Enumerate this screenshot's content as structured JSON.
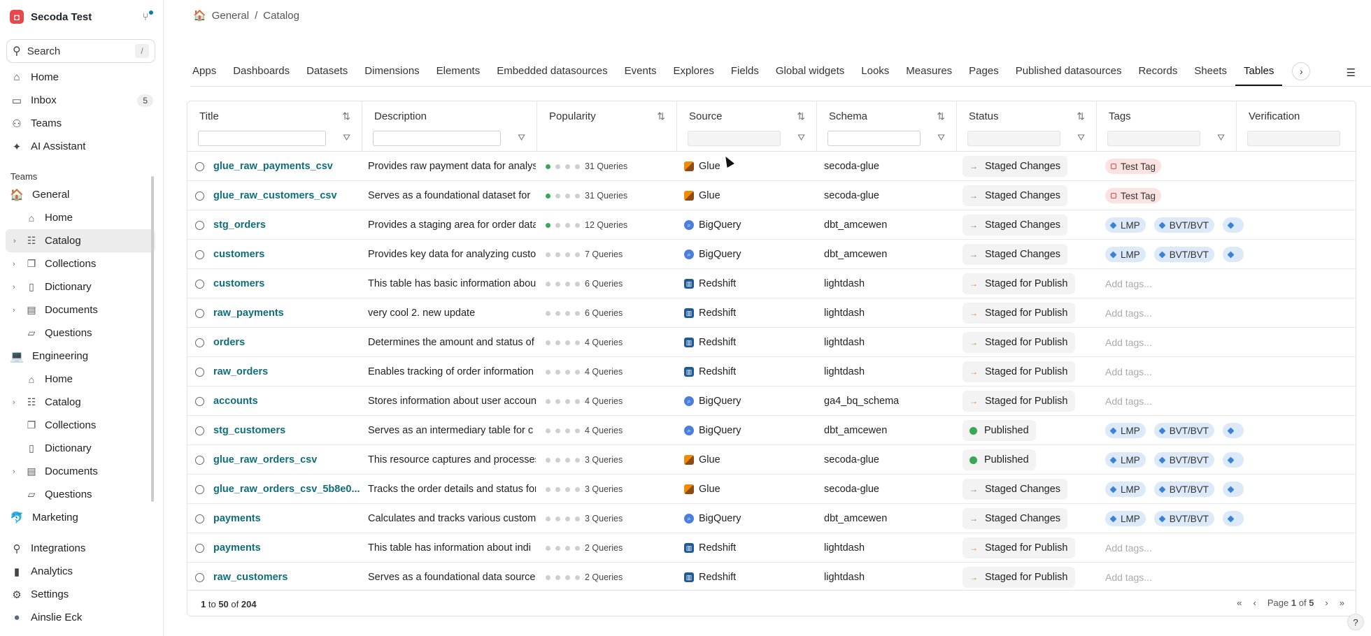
{
  "sidebar": {
    "workspace": "Secoda Test",
    "search": {
      "placeholder": "Search",
      "shortcut": "/"
    },
    "top_items": [
      {
        "label": "Home",
        "icon": "home-icon"
      },
      {
        "label": "Inbox",
        "icon": "inbox-icon",
        "badge": "5"
      },
      {
        "label": "Teams",
        "icon": "users-icon"
      },
      {
        "label": "AI Assistant",
        "icon": "sparkle-icon"
      }
    ],
    "teams_label": "Teams",
    "teams": [
      {
        "name": "General",
        "emoji": "🏠",
        "items": [
          {
            "label": "Home",
            "caret": false,
            "active": false
          },
          {
            "label": "Catalog",
            "caret": true,
            "active": true
          },
          {
            "label": "Collections",
            "caret": true,
            "active": false
          },
          {
            "label": "Dictionary",
            "caret": true,
            "active": false
          },
          {
            "label": "Documents",
            "caret": true,
            "active": false
          },
          {
            "label": "Questions",
            "caret": false,
            "active": false
          }
        ]
      },
      {
        "name": "Engineering",
        "emoji": "💻",
        "items": [
          {
            "label": "Home",
            "caret": false,
            "active": false
          },
          {
            "label": "Catalog",
            "caret": true,
            "active": false
          },
          {
            "label": "Collections",
            "caret": false,
            "active": false
          },
          {
            "label": "Dictionary",
            "caret": false,
            "active": false
          },
          {
            "label": "Documents",
            "caret": true,
            "active": false
          },
          {
            "label": "Questions",
            "caret": false,
            "active": false
          }
        ]
      },
      {
        "name": "Marketing",
        "emoji": "🐬",
        "items": []
      }
    ],
    "bottom_items": [
      {
        "label": "Integrations",
        "icon": "plug-icon"
      },
      {
        "label": "Analytics",
        "icon": "chart-icon"
      },
      {
        "label": "Settings",
        "icon": "gear-icon"
      },
      {
        "label": "Ainslie Eck",
        "icon": "avatar"
      }
    ]
  },
  "breadcrumb": {
    "team": "General",
    "sep": "/",
    "page": "Catalog"
  },
  "tabs": [
    "Apps",
    "Dashboards",
    "Datasets",
    "Dimensions",
    "Elements",
    "Embedded datasources",
    "Events",
    "Explores",
    "Fields",
    "Global widgets",
    "Looks",
    "Measures",
    "Pages",
    "Published datasources",
    "Records",
    "Sheets",
    "Tables"
  ],
  "active_tab": "Tables",
  "columns": {
    "title": "Title",
    "description": "Description",
    "popularity": "Popularity",
    "source": "Source",
    "schema": "Schema",
    "status": "Status",
    "tags": "Tags",
    "verification": "Verification"
  },
  "rows": [
    {
      "title": "glue_raw_payments_csv",
      "desc": "Provides raw payment data for analysis",
      "pop": 1,
      "queries": "31 Queries",
      "source": "Glue",
      "src": "glue",
      "schema": "secoda-glue",
      "status": "Staged Changes",
      "st": "changes",
      "tags": [
        {
          "t": "Test Tag",
          "k": "test"
        }
      ]
    },
    {
      "title": "glue_raw_customers_csv",
      "desc": "Serves as a foundational dataset for",
      "pop": 1,
      "queries": "31 Queries",
      "source": "Glue",
      "src": "glue",
      "schema": "secoda-glue",
      "status": "Staged Changes",
      "st": "changes",
      "tags": [
        {
          "t": "Test Tag",
          "k": "test"
        }
      ]
    },
    {
      "title": "stg_orders",
      "desc": "Provides a staging area for order data",
      "pop": 1,
      "queries": "12 Queries",
      "source": "BigQuery",
      "src": "bq",
      "schema": "dbt_amcewen",
      "status": "Staged Changes",
      "st": "changes",
      "tags": [
        {
          "t": "LMP",
          "k": "blue"
        },
        {
          "t": "BVT/BVT",
          "k": "blue"
        },
        {
          "t": "",
          "k": "blue"
        }
      ]
    },
    {
      "title": "customers",
      "desc": "Provides key data for analyzing customers",
      "pop": 0,
      "queries": "7 Queries",
      "source": "BigQuery",
      "src": "bq",
      "schema": "dbt_amcewen",
      "status": "Staged Changes",
      "st": "changes",
      "tags": [
        {
          "t": "LMP",
          "k": "blue"
        },
        {
          "t": "BVT/BVT",
          "k": "blue"
        },
        {
          "t": "",
          "k": "blue"
        }
      ]
    },
    {
      "title": "customers",
      "desc": "This table has basic information about",
      "pop": 0,
      "queries": "6 Queries",
      "source": "Redshift",
      "src": "rs",
      "schema": "lightdash",
      "status": "Staged for Publish",
      "st": "publish",
      "tags": []
    },
    {
      "title": "raw_payments",
      "desc": "very cool 2. new update",
      "pop": 0,
      "queries": "6 Queries",
      "source": "Redshift",
      "src": "rs",
      "schema": "lightdash",
      "status": "Staged for Publish",
      "st": "publish",
      "tags": []
    },
    {
      "title": "orders",
      "desc": "Determines the amount and status of",
      "pop": 0,
      "queries": "4 Queries",
      "source": "Redshift",
      "src": "rs",
      "schema": "lightdash",
      "status": "Staged for Publish",
      "st": "publish",
      "tags": []
    },
    {
      "title": "raw_orders",
      "desc": "Enables tracking of order information",
      "pop": 0,
      "queries": "4 Queries",
      "source": "Redshift",
      "src": "rs",
      "schema": "lightdash",
      "status": "Staged for Publish",
      "st": "publish",
      "tags": []
    },
    {
      "title": "accounts",
      "desc": "Stores information about user accounts",
      "pop": 0,
      "queries": "4 Queries",
      "source": "BigQuery",
      "src": "bq",
      "schema": "ga4_bq_schema",
      "status": "Staged for Publish",
      "st": "publish",
      "tags": []
    },
    {
      "title": "stg_customers",
      "desc": "Serves as an intermediary table for c",
      "pop": 0,
      "queries": "4 Queries",
      "source": "BigQuery",
      "src": "bq",
      "schema": "dbt_amcewen",
      "status": "Published",
      "st": "published",
      "tags": [
        {
          "t": "LMP",
          "k": "blue"
        },
        {
          "t": "BVT/BVT",
          "k": "blue"
        },
        {
          "t": "",
          "k": "blue"
        }
      ]
    },
    {
      "title": "glue_raw_orders_csv",
      "desc": "This resource captures and processes",
      "pop": 0,
      "queries": "3 Queries",
      "source": "Glue",
      "src": "glue",
      "schema": "secoda-glue",
      "status": "Published",
      "st": "published",
      "tags": [
        {
          "t": "LMP",
          "k": "blue"
        },
        {
          "t": "BVT/BVT",
          "k": "blue"
        },
        {
          "t": "",
          "k": "blue"
        }
      ]
    },
    {
      "title": "glue_raw_orders_csv_5b8e0...",
      "desc": "Tracks the order details and status for",
      "pop": 0,
      "queries": "3 Queries",
      "source": "Glue",
      "src": "glue",
      "schema": "secoda-glue",
      "status": "Staged Changes",
      "st": "changes",
      "tags": [
        {
          "t": "LMP",
          "k": "blue"
        },
        {
          "t": "BVT/BVT",
          "k": "blue"
        },
        {
          "t": "",
          "k": "blue"
        }
      ]
    },
    {
      "title": "payments",
      "desc": "Calculates and tracks various customer",
      "pop": 0,
      "queries": "3 Queries",
      "source": "BigQuery",
      "src": "bq",
      "schema": "dbt_amcewen",
      "status": "Staged Changes",
      "st": "changes",
      "tags": [
        {
          "t": "LMP",
          "k": "blue"
        },
        {
          "t": "BVT/BVT",
          "k": "blue"
        },
        {
          "t": "",
          "k": "blue"
        }
      ]
    },
    {
      "title": "payments",
      "desc": "This table has information about indi",
      "pop": 0,
      "queries": "2 Queries",
      "source": "Redshift",
      "src": "rs",
      "schema": "lightdash",
      "status": "Staged for Publish",
      "st": "publish",
      "tags": []
    },
    {
      "title": "raw_customers",
      "desc": "Serves as a foundational data source",
      "pop": 0,
      "queries": "2 Queries",
      "source": "Redshift",
      "src": "rs",
      "schema": "lightdash",
      "status": "Staged for Publish",
      "st": "publish",
      "tags": []
    }
  ],
  "add_tags_placeholder": "Add tags...",
  "footer": {
    "range_start": "1",
    "to": "to",
    "range_end": "50",
    "of": "of",
    "total": "204",
    "page_label": "Page",
    "page": "1",
    "page_of": "of",
    "pages": "5"
  },
  "help_label": "?"
}
